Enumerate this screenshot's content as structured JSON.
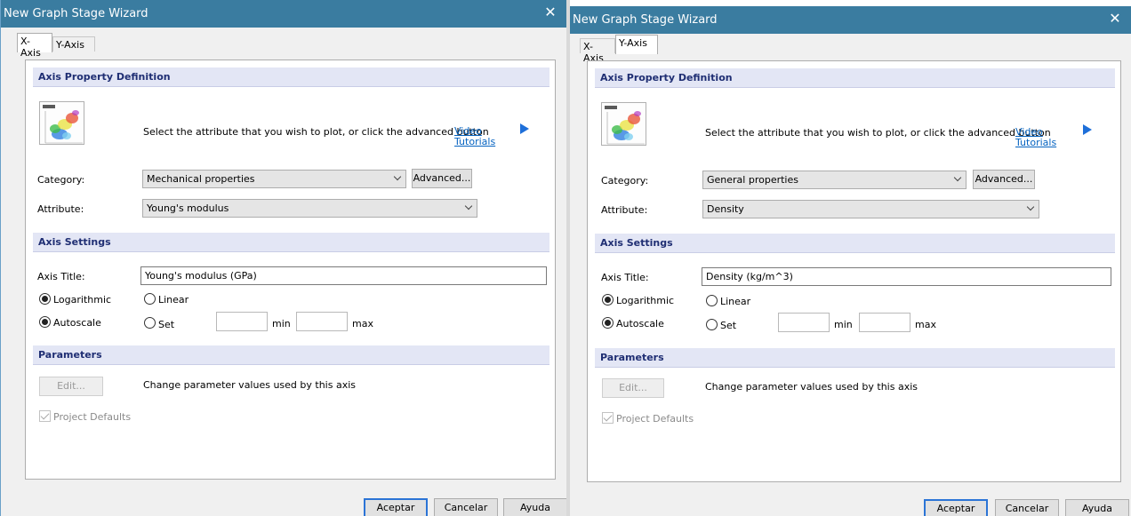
{
  "windows": [
    {
      "title": "New Graph Stage Wizard",
      "close_glyph": "✕",
      "tabs": [
        {
          "label": "X-Axis",
          "active": true
        },
        {
          "label": "Y-Axis",
          "active": false
        }
      ],
      "axis_property": {
        "header": "Axis Property Definition",
        "instruction": "Select the attribute that you wish to plot, or click the advanced button",
        "video_label": "Video",
        "tutorials_label": "Tutorials",
        "category_label": "Category:",
        "category_value": "Mechanical properties",
        "advanced_label": "Advanced...",
        "attribute_label": "Attribute:",
        "attribute_value": "Young's modulus"
      },
      "axis_settings": {
        "header": "Axis Settings",
        "axis_title_label": "Axis Title:",
        "axis_title_value": "Young's modulus (GPa)",
        "logarithmic_label": "Logarithmic",
        "linear_label": "Linear",
        "autoscale_label": "Autoscale",
        "set_label": "Set",
        "min_label": "min",
        "max_label": "max",
        "logarithmic_selected": true,
        "autoscale_selected": true
      },
      "parameters": {
        "header": "Parameters",
        "edit_label": "Edit...",
        "description": "Change parameter values used by this axis",
        "project_defaults_label": "Project Defaults"
      },
      "buttons": {
        "ok": "Aceptar",
        "cancel": "Cancelar",
        "help": "Ayuda"
      }
    },
    {
      "title": "New Graph Stage Wizard",
      "close_glyph": "✕",
      "tabs": [
        {
          "label": "X-Axis",
          "active": false
        },
        {
          "label": "Y-Axis",
          "active": true
        }
      ],
      "axis_property": {
        "header": "Axis Property Definition",
        "instruction": "Select the attribute that you wish to plot, or click the advanced button",
        "video_label": "Video",
        "tutorials_label": "Tutorials",
        "category_label": "Category:",
        "category_value": "General properties",
        "advanced_label": "Advanced...",
        "attribute_label": "Attribute:",
        "attribute_value": "Density"
      },
      "axis_settings": {
        "header": "Axis Settings",
        "axis_title_label": "Axis Title:",
        "axis_title_value": "Density (kg/m^3)",
        "logarithmic_label": "Logarithmic",
        "linear_label": "Linear",
        "autoscale_label": "Autoscale",
        "set_label": "Set",
        "min_label": "min",
        "max_label": "max",
        "logarithmic_selected": true,
        "autoscale_selected": true
      },
      "parameters": {
        "header": "Parameters",
        "edit_label": "Edit...",
        "description": "Change parameter values used by this axis",
        "project_defaults_label": "Project Defaults"
      },
      "buttons": {
        "ok": "Aceptar",
        "cancel": "Cancelar",
        "help": "Ayuda"
      }
    }
  ],
  "colors": {
    "titlebar": "#3a7ca0",
    "section_header_bg": "#e3e6f5",
    "section_header_text": "#1f2e73",
    "link": "#0563c1",
    "play": "#1e6fd9",
    "primary_border": "#2b74d6"
  },
  "icons": [
    "close-icon",
    "chevron-down-icon",
    "play-icon",
    "chart-thumbnail"
  ]
}
